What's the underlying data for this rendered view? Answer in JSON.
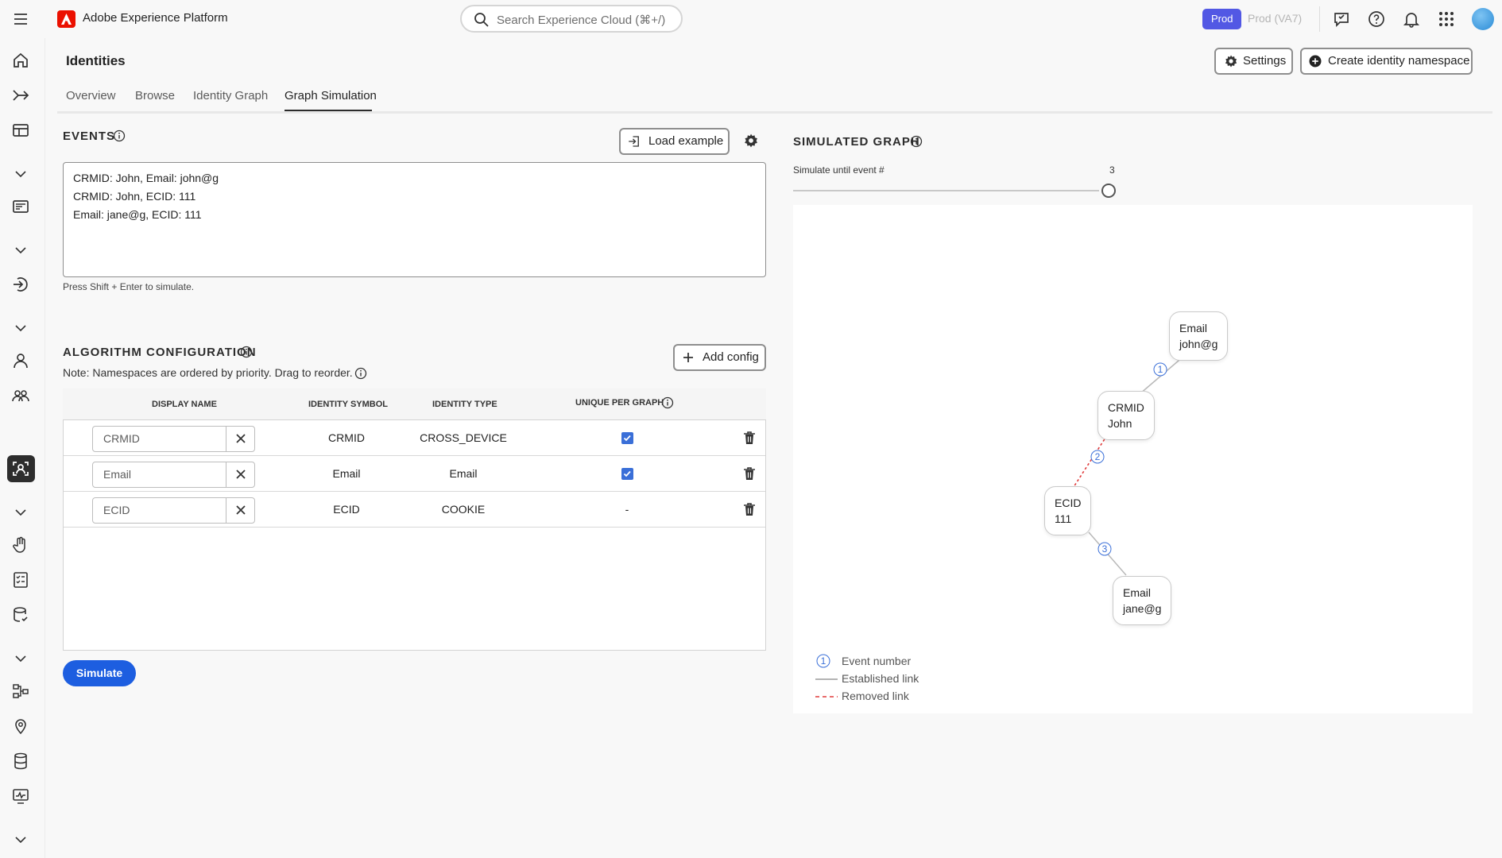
{
  "app": {
    "brand_name": "Adobe Experience Platform",
    "search_placeholder": "Search Experience Cloud (⌘+/)",
    "org_badge": "Prod",
    "org_alt": "Prod (VA7)"
  },
  "page": {
    "title": "Identities",
    "tabs": [
      {
        "label": "Overview"
      },
      {
        "label": "Browse"
      },
      {
        "label": "Identity Graph"
      },
      {
        "label": "Graph Simulation",
        "active": true
      }
    ],
    "settings_label": "Settings",
    "create_label": "Create identity namespace"
  },
  "events": {
    "title": "EVENTS",
    "load_example_label": "Load example",
    "lines": [
      "CRMID: John, Email: john@g",
      "CRMID: John, ECID: 111",
      "Email: jane@g, ECID: 111"
    ],
    "hint": "Press Shift + Enter to simulate."
  },
  "algorithm": {
    "title": "ALGORITHM CONFIGURATION",
    "note": "Note: Namespaces are ordered by priority. Drag to reorder.",
    "add_config_label": "Add config",
    "columns": [
      "DISPLAY NAME",
      "IDENTITY SYMBOL",
      "IDENTITY TYPE",
      "UNIQUE PER GRAPH"
    ],
    "rows": [
      {
        "display_name": "CRMID",
        "symbol": "CRMID",
        "type": "CROSS_DEVICE",
        "unique": true
      },
      {
        "display_name": "Email",
        "symbol": "Email",
        "type": "Email",
        "unique": true
      },
      {
        "display_name": "ECID",
        "symbol": "ECID",
        "type": "COOKIE",
        "unique": false,
        "unique_text": "-"
      }
    ],
    "simulate_label": "Simulate"
  },
  "simulated_graph": {
    "title": "SIMULATED GRAPH",
    "slider_label": "Simulate until event #",
    "slider_value": "3",
    "slider_fraction": 1.0,
    "nodes": [
      {
        "namespace": "Email",
        "value": "john@g"
      },
      {
        "namespace": "CRMID",
        "value": "John"
      },
      {
        "namespace": "ECID",
        "value": "111"
      },
      {
        "namespace": "Email",
        "value": "jane@g"
      }
    ],
    "edges": [
      {
        "event": "1",
        "status": "established"
      },
      {
        "event": "2",
        "status": "removed"
      },
      {
        "event": "3",
        "status": "established"
      }
    ],
    "legend": {
      "event_number": "Event number",
      "established": "Established link",
      "removed": "Removed link",
      "sample_number": "1"
    },
    "colors": {
      "established": "#b9b9b9",
      "removed": "#e03a3a",
      "event_badge": "#3a6fd8"
    }
  }
}
